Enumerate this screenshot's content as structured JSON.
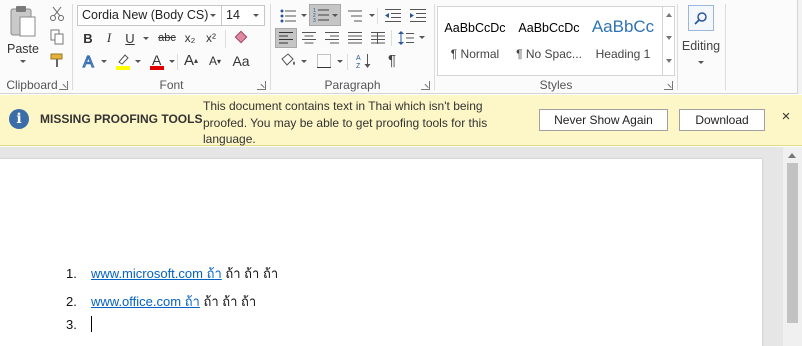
{
  "ribbon": {
    "clipboard": {
      "label": "Clipboard",
      "paste_label": "Paste"
    },
    "font": {
      "label": "Font",
      "font_name": "Cordia New (Body CS)",
      "font_size": "14",
      "bold": "B",
      "italic": "I",
      "underline": "U",
      "strikethrough": "abc",
      "subscript": "x₂",
      "superscript": "x²",
      "grow": "A",
      "shrink": "A"
    },
    "paragraph": {
      "label": "Paragraph",
      "pilcrow": "¶"
    },
    "styles": {
      "label": "Styles",
      "items": [
        {
          "sample": "AaBbCcDc",
          "name": "¶ Normal"
        },
        {
          "sample": "AaBbCcDc",
          "name": "¶ No Spac..."
        },
        {
          "sample": "AaBbCc",
          "name": "Heading 1"
        }
      ]
    },
    "editing": {
      "label": "Editing"
    },
    "accent_color": "#2b579a"
  },
  "message_bar": {
    "title": "MISSING PROOFING TOOLS",
    "text": "This document contains text in Thai which isn't being proofed. You may be able to get proofing tools for this language.",
    "never_show_label": "Never Show Again",
    "download_label": "Download",
    "close_glyph": "×"
  },
  "document": {
    "list": [
      {
        "number": "1.",
        "link": "www.microsoft.com",
        "link_thai": " ถ้า",
        "rest": " ถ้า ถ้า ถ้า"
      },
      {
        "number": "2.",
        "link": "www.office.com",
        "link_thai": " ถ้า",
        "rest": " ถ้า ถ้า ถ้า"
      },
      {
        "number": "3.",
        "link": "",
        "link_thai": "",
        "rest": ""
      }
    ]
  }
}
